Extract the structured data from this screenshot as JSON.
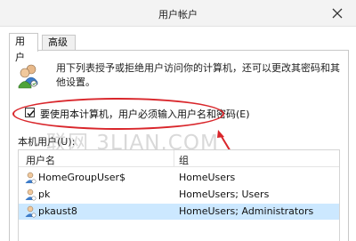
{
  "window": {
    "title": "用户帐户",
    "close_icon": "close-icon"
  },
  "tabs": [
    {
      "label": "用户",
      "active": true
    },
    {
      "label": "高级",
      "active": false
    }
  ],
  "intro_text": "用下列表授予或拒绝用户访问你的计算机，还可以更改其密码和其他设置。",
  "checkbox": {
    "label": "要使用本计算机，用户必须输入用户名和密码(E)",
    "checked": true
  },
  "machine_users_label": "本机用户(U):",
  "watermark": "联网 3LIAN.COM",
  "users_table": {
    "columns": [
      "用户名",
      "组"
    ],
    "rows": [
      {
        "name": "HomeGroupUser$",
        "group": "HomeUsers",
        "icon": "user-icon",
        "selected": false
      },
      {
        "name": "pk",
        "group": "HomeUsers; Users",
        "icon": "user-icon",
        "selected": false
      },
      {
        "name": "pkaust8",
        "group": "HomeUsers; Administrators",
        "icon": "user-icon",
        "selected": true
      }
    ]
  },
  "colors": {
    "annotation": "#d9262b",
    "selection": "#cce8ff",
    "titlebar": "#f3f3f3"
  }
}
